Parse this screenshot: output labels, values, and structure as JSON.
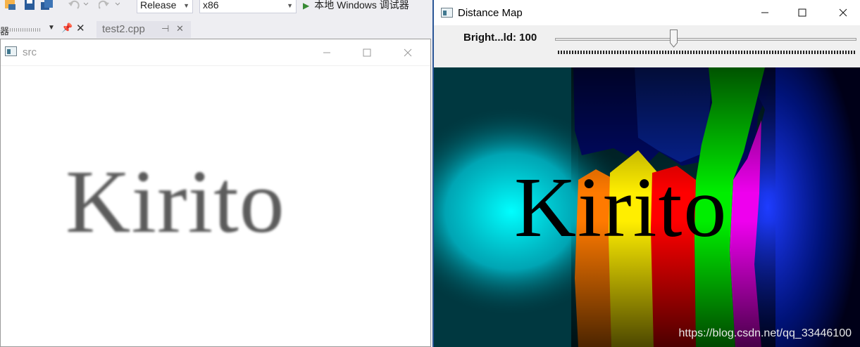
{
  "vs": {
    "config_value": "Release",
    "platform_value": "x86",
    "run_label": "本地 Windows 调试器",
    "panel_label": "器",
    "doc_tab": "test2.cpp"
  },
  "src_window": {
    "title": "src",
    "image_text": "Kirito"
  },
  "dm_window": {
    "title": "Distance Map",
    "trackbar_label": "Bright...ld: 100",
    "trackbar_value": 100,
    "image_text": "Kirito",
    "watermark": "https://blog.csdn.net/qq_33446100"
  },
  "colors": {
    "cyan": "#00f0f0",
    "navy": "#00007a",
    "blue": "#0026ff",
    "orange": "#ff7a00",
    "yellow": "#ffee00",
    "red": "#ff0000",
    "green": "#00ee00",
    "magenta": "#ee00ee",
    "window_accent": "#2b5797"
  },
  "icons": [
    "undo-icon",
    "redo-icon",
    "play-icon",
    "pin-icon",
    "close-icon",
    "minimize-icon",
    "maximize-icon",
    "app-window-icon"
  ]
}
